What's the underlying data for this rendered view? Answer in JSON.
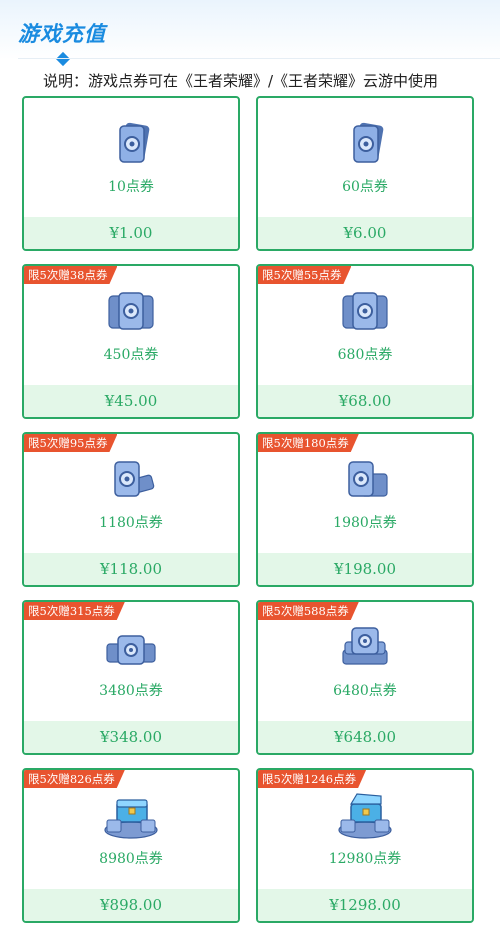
{
  "header": {
    "title": "游戏充值"
  },
  "description": "说明：游戏点券可在《王者荣耀》/《王者荣耀》云游中使用",
  "colors": {
    "accent": "#2aa965",
    "promo": "#e8542f",
    "title": "#1a8be0"
  },
  "cards": [
    {
      "amount": "10点券",
      "price": "¥1.00",
      "promo": "",
      "icon": "coupon-card-icon"
    },
    {
      "amount": "60点券",
      "price": "¥6.00",
      "promo": "",
      "icon": "coupon-card-icon"
    },
    {
      "amount": "450点券",
      "price": "¥45.00",
      "promo": "限5次赠38点券",
      "icon": "coupon-stack-icon"
    },
    {
      "amount": "680点券",
      "price": "¥68.00",
      "promo": "限5次赠55点券",
      "icon": "coupon-stack-icon"
    },
    {
      "amount": "1180点券",
      "price": "¥118.00",
      "promo": "限5次赠95点券",
      "icon": "coupon-stack-icon"
    },
    {
      "amount": "1980点券",
      "price": "¥198.00",
      "promo": "限5次赠180点券",
      "icon": "coupon-stack-icon"
    },
    {
      "amount": "3480点券",
      "price": "¥348.00",
      "promo": "限5次赠315点券",
      "icon": "coupon-pile-icon"
    },
    {
      "amount": "6480点券",
      "price": "¥648.00",
      "promo": "限5次赠588点券",
      "icon": "coupon-pile-icon"
    },
    {
      "amount": "8980点券",
      "price": "¥898.00",
      "promo": "限5次赠826点券",
      "icon": "treasure-chest-icon"
    },
    {
      "amount": "12980点券",
      "price": "¥1298.00",
      "promo": "限5次赠1246点券",
      "icon": "treasure-chest-icon"
    }
  ]
}
